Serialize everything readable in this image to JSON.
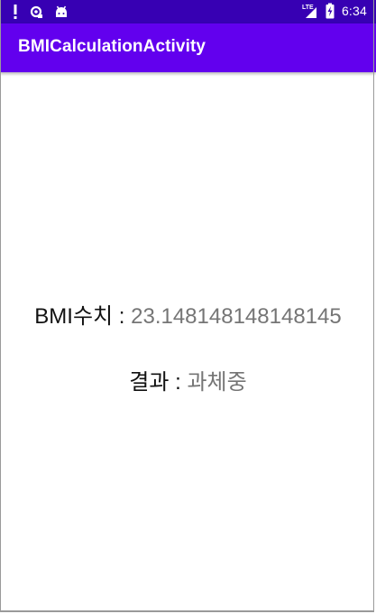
{
  "status_bar": {
    "time": "6:34",
    "lte": "LTE",
    "icons": [
      "alert-icon",
      "sync-icon",
      "android-icon",
      "signal-icon",
      "battery-charging-icon"
    ],
    "background": "#3700b3"
  },
  "app_bar": {
    "title": "BMICalculationActivity",
    "background": "#6200ee"
  },
  "main": {
    "bmi_label": "BMI수치 : ",
    "bmi_value": "23.148148148148145",
    "result_label": "결과 : ",
    "result_value": "과체중"
  }
}
